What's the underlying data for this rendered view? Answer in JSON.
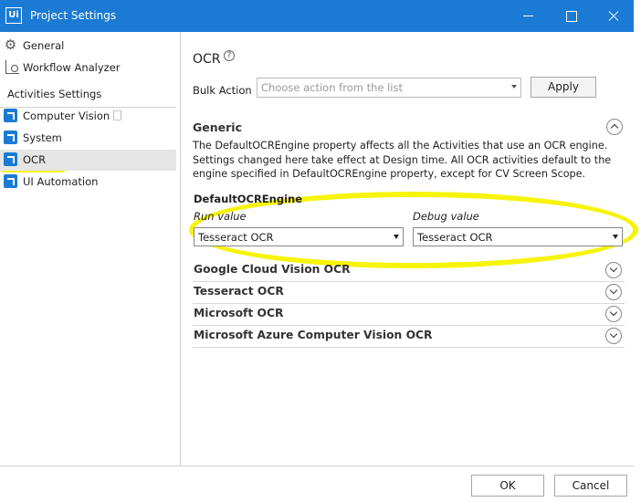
{
  "window": {
    "title": "Project Settings",
    "logo_text": "Ui",
    "accent_color": "#1b7bd4"
  },
  "sidebar": {
    "items": [
      {
        "label": "General",
        "icon": "gear-icon"
      },
      {
        "label": "Workflow Analyzer",
        "icon": "workflow-analyzer-icon"
      }
    ],
    "section_header": "Activities Settings",
    "activity_items": [
      {
        "label": "Computer Vision 🗌",
        "icon": "activity-package-icon"
      },
      {
        "label": "System",
        "icon": "activity-package-icon"
      },
      {
        "label": "OCR",
        "icon": "activity-package-icon",
        "selected": true
      },
      {
        "label": "UI Automation",
        "icon": "activity-package-icon"
      }
    ],
    "highlight_color": "#f6f40a"
  },
  "main": {
    "title": "OCR",
    "help_glyph": "?",
    "bulk_action": {
      "label": "Bulk Action",
      "placeholder": "Choose action from the list",
      "apply_label": "Apply"
    },
    "generic": {
      "title": "Generic",
      "description": "The DefaultOCREngine property affects all the Activities that use an OCR engine. Settings changed here take effect at Design time. All OCR activities default to the engine specified in DefaultOCREngine property, except for CV Screen Scope.",
      "engine_title": "DefaultOCREngine",
      "run_label": "Run value",
      "debug_label": "Debug value",
      "run_value": "Tesseract OCR",
      "debug_value": "Tesseract OCR"
    },
    "sections": [
      "Google Cloud Vision OCR",
      "Tesseract OCR",
      "Microsoft OCR",
      "Microsoft Azure Computer Vision OCR"
    ]
  },
  "footer": {
    "ok_label": "OK",
    "cancel_label": "Cancel"
  }
}
